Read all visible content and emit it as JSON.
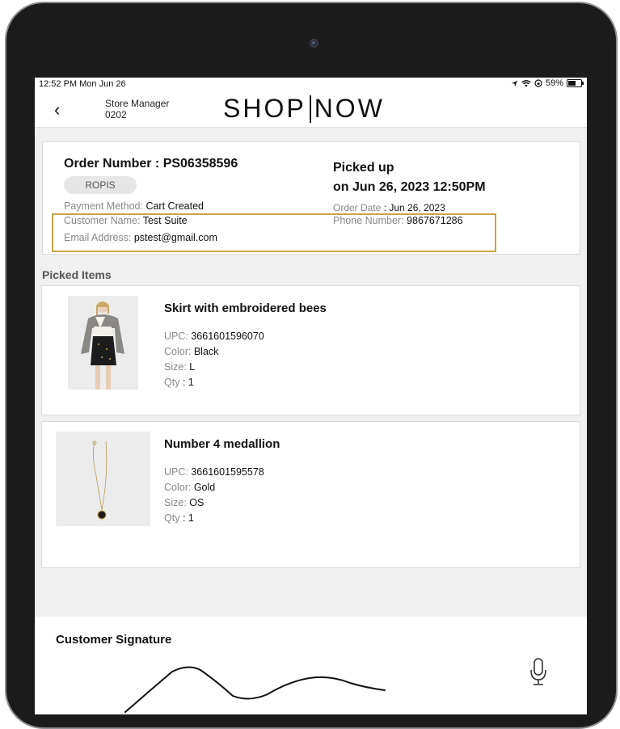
{
  "status_bar": {
    "time": "12:52 PM  Mon Jun 26",
    "battery": "59%"
  },
  "header": {
    "back_label": "‹",
    "store_role": "Store Manager",
    "store_id": "0202",
    "logo_left": "SHOP",
    "logo_right": "NOW"
  },
  "order": {
    "number_label": "Order Number : PS06358596",
    "type_tag": "ROPIS",
    "payment_label": "Payment Method:",
    "payment_value": "Cart Created",
    "customer_label": "Customer Name:",
    "customer_value": "Test Suite",
    "email_label": "Email Address:",
    "email_value": "pstest@gmail.com",
    "status_line1": "Picked up",
    "status_line2": "on Jun 26, 2023 12:50PM",
    "order_date_label": "Order Date",
    "order_date_value": ": Jun 26, 2023",
    "phone_label": "Phone Number:",
    "phone_value": "9867671286"
  },
  "picked_items_title": "Picked Items",
  "items": [
    {
      "title": "Skirt with embroidered bees",
      "upc_label": "UPC:",
      "upc": "3661601596070",
      "color_label": "Color:",
      "color": "Black",
      "size_label": "Size:",
      "size": "L",
      "qty_label": "Qty",
      "qty": ": 1"
    },
    {
      "title": "Number 4 medallion",
      "upc_label": "UPC:",
      "upc": "3661601595578",
      "color_label": "Color:",
      "color": "Gold",
      "size_label": "Size:",
      "size": "OS",
      "qty_label": "Qty",
      "qty": ": 1"
    }
  ],
  "signature": {
    "title": "Customer Signature"
  },
  "colors": {
    "highlight": "#c9a24a",
    "device": "#1b1b1c",
    "background": "#f0f0f0"
  }
}
